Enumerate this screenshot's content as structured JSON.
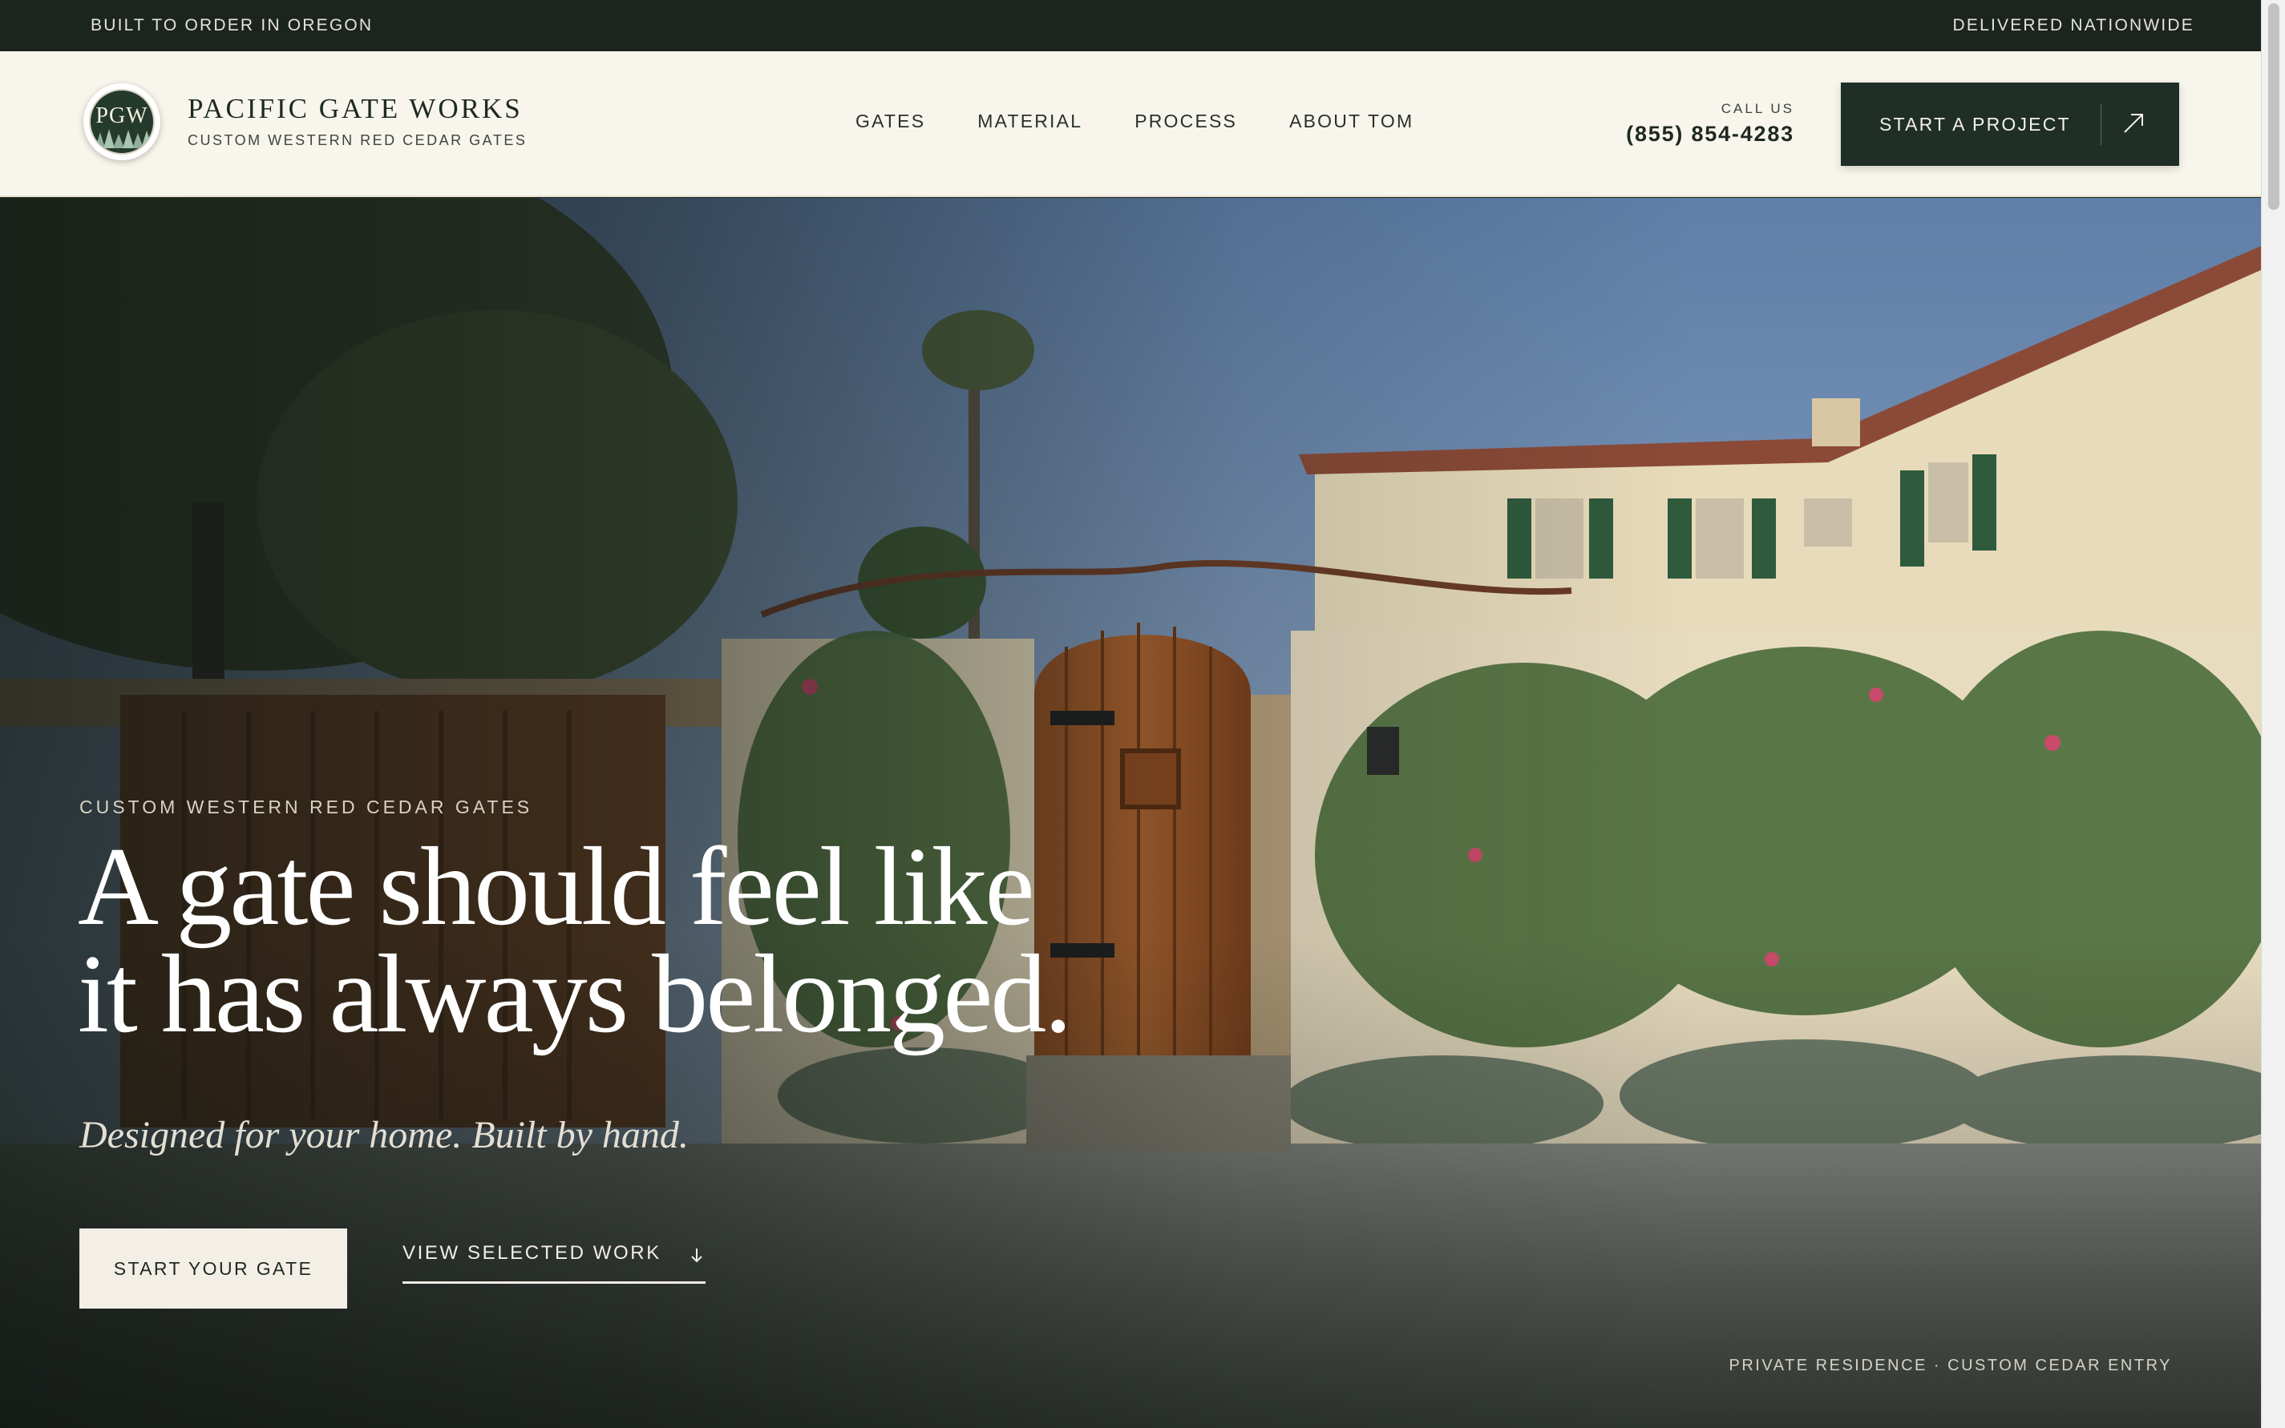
{
  "topbar": {
    "left": "BUILT TO ORDER IN OREGON",
    "right": "DELIVERED NATIONWIDE"
  },
  "brand": {
    "logo_text": "PGW",
    "name": "PACIFIC GATE WORKS",
    "tagline": "CUSTOM WESTERN RED CEDAR GATES"
  },
  "nav": {
    "items": [
      {
        "label": "GATES"
      },
      {
        "label": "MATERIAL"
      },
      {
        "label": "PROCESS"
      },
      {
        "label": "ABOUT TOM"
      }
    ]
  },
  "contact": {
    "label": "CALL US",
    "phone": "(855) 854-4283"
  },
  "header_cta": {
    "label": "START A PROJECT",
    "icon": "arrow-up-right-icon"
  },
  "hero": {
    "eyebrow": "CUSTOM WESTERN RED CEDAR GATES",
    "headline_line1": "A gate should feel like",
    "headline_line2": "it has always belonged.",
    "subline": "Designed for your home. Built by hand.",
    "primary_button": "START YOUR GATE",
    "secondary_link": "VIEW SELECTED WORK",
    "secondary_icon": "arrow-down-icon",
    "caption": "PRIVATE RESIDENCE · CUSTOM CEDAR ENTRY"
  },
  "colors": {
    "topbar_bg": "#1c241f",
    "header_bg": "#f8f5ec",
    "cta_bg": "#1f2f27",
    "accent_cream": "#f3efe6"
  }
}
